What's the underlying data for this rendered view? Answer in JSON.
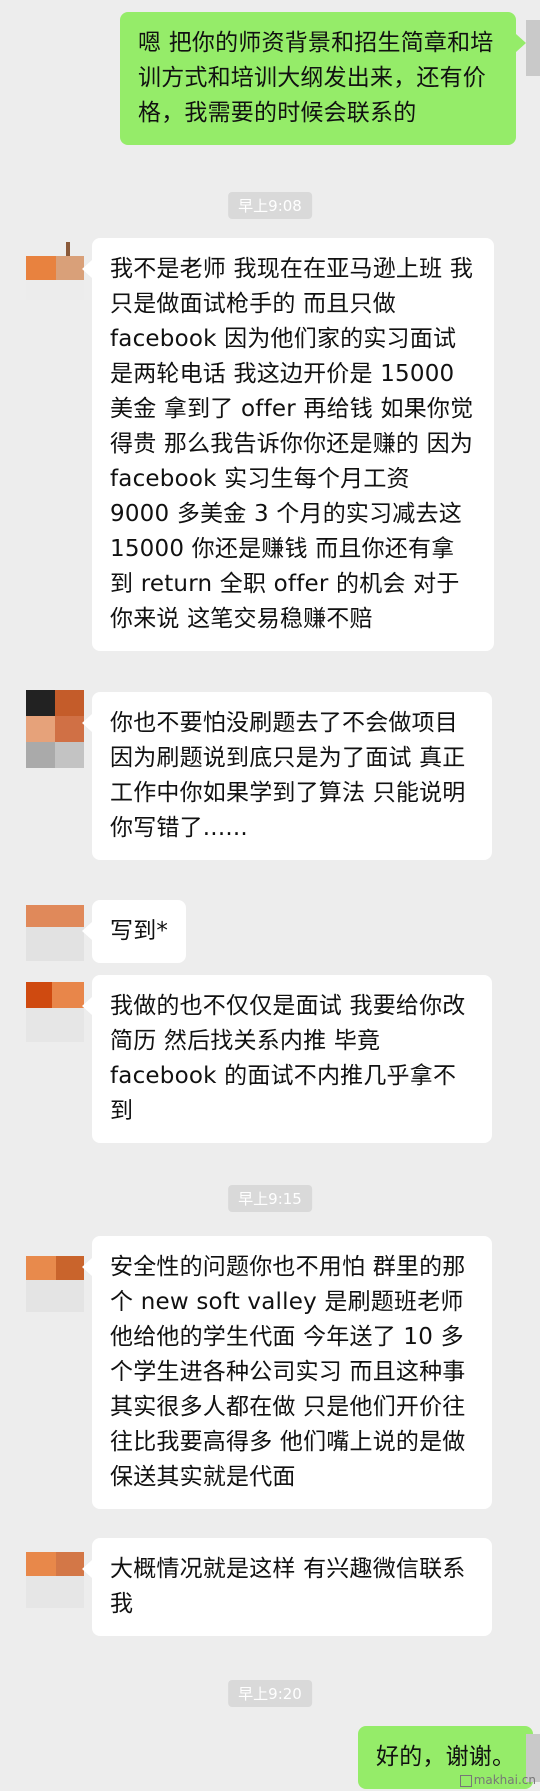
{
  "chat": {
    "messages": [
      {
        "from": "me",
        "text": "嗯 把你的师资背景和招生简章和培训方式和培训大纲发出来，还有价格，我需要的时候会联系的"
      },
      {
        "from": "other",
        "text": "我不是老师 我现在在亚马逊上班 我只是做面试枪手的 而且只做facebook 因为他们家的实习面试是两轮电话 我这边开价是 15000 美金 拿到了 offer 再给钱 如果你觉得贵 那么我告诉你你还是赚的 因为facebook 实习生每个月工资 9000 多美金 3 个月的实习减去这 15000 你还是赚钱 而且你还有拿到 return 全职 offer 的机会 对于你来说 这笔交易稳赚不赔"
      },
      {
        "from": "other",
        "text": "你也不要怕没刷题去了不会做项目 因为刷题说到底只是为了面试 真正工作中你如果学到了算法 只能说明你写错了......"
      },
      {
        "from": "other",
        "text": "写到*"
      },
      {
        "from": "other",
        "text": "我做的也不仅仅是面试 我要给你改简历 然后找关系内推 毕竟 facebook 的面试不内推几乎拿不到"
      },
      {
        "from": "other",
        "text": "安全性的问题你也不用怕 群里的那个 new soft valley 是刷题班老师 他给他的学生代面 今年送了 10 多个学生进各种公司实习 而且这种事其实很多人都在做 只是他们开价往往比我要高得多 他们嘴上说的是做保送其实就是代面"
      },
      {
        "from": "other",
        "text": "大概情况就是这样 有兴趣微信联系我"
      },
      {
        "from": "me",
        "text": "好的，谢谢。"
      }
    ],
    "timestamps": [
      "早上9:08",
      "早上9:15",
      "早上9:20"
    ]
  },
  "watermark": "makhai.cn",
  "colors": {
    "background": "#ededed",
    "incoming_bubble": "#ffffff",
    "outgoing_bubble": "#95ec69",
    "timestamp_bg": "#d9d9d9"
  }
}
